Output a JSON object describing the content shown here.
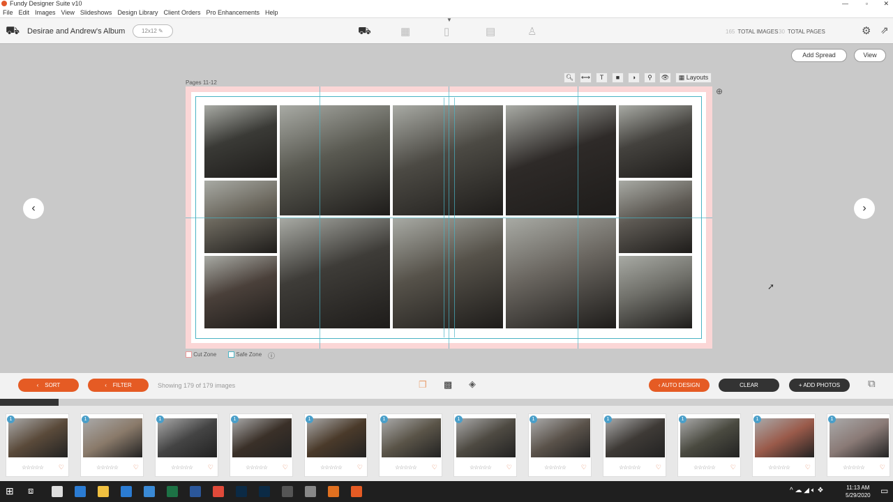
{
  "app": {
    "title": "Fundy Designer Suite v10"
  },
  "menu": [
    "File",
    "Edit",
    "Images",
    "View",
    "Slideshows",
    "Design Library",
    "Client Orders",
    "Pro Enhancements",
    "Help"
  ],
  "toolbar": {
    "album_title": "Desirae and Andrew's Album",
    "album_size": "12x12",
    "total_images_count": "165",
    "total_images_label": "TOTAL IMAGES",
    "total_pages_count": "30",
    "total_pages_label": "TOTAL PAGES",
    "nav_icons": [
      "album-design-icon",
      "proofing-icon",
      "wall-art-icon",
      "cards-icon",
      "sales-icon"
    ]
  },
  "canvas": {
    "add_spread": "Add Spread",
    "view": "View",
    "pages_label": "Pages 11-12",
    "layouts": "Layouts",
    "cut_zone": "Cut Zone",
    "safe_zone": "Safe Zone",
    "tools": [
      "zoom-icon",
      "ruler-icon",
      "text-icon",
      "shadow-icon",
      "color-icon",
      "eyedropper-icon",
      "preview-icon"
    ]
  },
  "bottom": {
    "sort": "SORT",
    "filter": "FILTER",
    "showing": "Showing 179 of 179 images",
    "auto_design": "AUTO DESIGN",
    "clear": "CLEAR",
    "add_photos": "+ ADD PHOTOS",
    "scroll_progress": 0.066
  },
  "filmstrip": [
    {
      "badge": "1",
      "tone": "#5a4a3a"
    },
    {
      "badge": "1",
      "tone": "#8a7a6a"
    },
    {
      "badge": "1",
      "tone": "#444"
    },
    {
      "badge": "1",
      "tone": "#3a3028"
    },
    {
      "badge": "1",
      "tone": "#4a3a2a"
    },
    {
      "badge": "1",
      "tone": "#5a5448"
    },
    {
      "badge": "1",
      "tone": "#4e4a42"
    },
    {
      "badge": "1",
      "tone": "#5a524a"
    },
    {
      "badge": "1",
      "tone": "#3e3a36"
    },
    {
      "badge": "1",
      "tone": "#4a4a40"
    },
    {
      "badge": "1",
      "tone": "#9a5a4a"
    },
    {
      "badge": "1",
      "tone": "#8a7a76"
    }
  ],
  "stars": "☆☆☆☆☆",
  "taskbar": {
    "time": "11:13 AM",
    "date": "5/29/2020"
  },
  "colors": {
    "accent": "#e55b24",
    "dark_button": "#333333",
    "badge": "#4a9fc9",
    "guide": "#49b3c4"
  }
}
